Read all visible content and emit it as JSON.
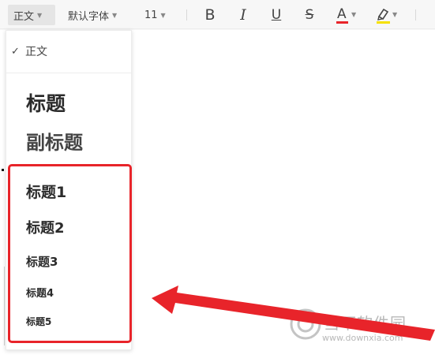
{
  "toolbar": {
    "style_label": "正文",
    "font_label": "默认字体",
    "size_label": "11",
    "bold_label": "B",
    "italic_label": "I",
    "underline_label": "U",
    "strike_label": "S",
    "font_color_label": "A",
    "font_color": "#e8242a",
    "highlight_color": "#f5e100"
  },
  "dropdown": {
    "normal": "正文",
    "title": "标题",
    "subtitle": "副标题",
    "heading1": "标题1",
    "heading2": "标题2",
    "heading3": "标题3",
    "heading4": "标题4",
    "heading5": "标题5",
    "selected": "正文"
  },
  "annotation": {
    "box_color": "#e8242a",
    "arrow_color": "#e8242a"
  },
  "watermark": {
    "name": "当下软件园",
    "url": "www.downxia.com"
  }
}
